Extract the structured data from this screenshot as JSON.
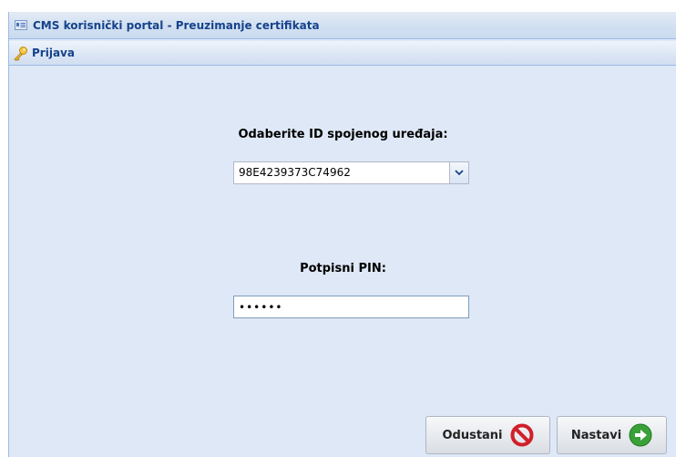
{
  "window": {
    "title": "CMS korisnički portal - Preuzimanje certifikata",
    "title_icon": "card-icon"
  },
  "panel": {
    "title": "Prijava",
    "icon": "key-icon"
  },
  "form": {
    "device_label": "Odaberite ID spojenog uređaja:",
    "device_selected": "98E4239373C74962",
    "pin_label": "Potpisni PIN:",
    "pin_value": "••••••"
  },
  "buttons": {
    "cancel_label": "Odustani",
    "cancel_icon": "forbidden-icon",
    "next_label": "Nastavi",
    "next_icon": "arrow-right-icon"
  },
  "colors": {
    "header_text": "#15428b",
    "border": "#99bbe8",
    "background": "#dfe8f6",
    "cancel_red": "#d0202a",
    "next_green": "#3aa13a"
  }
}
